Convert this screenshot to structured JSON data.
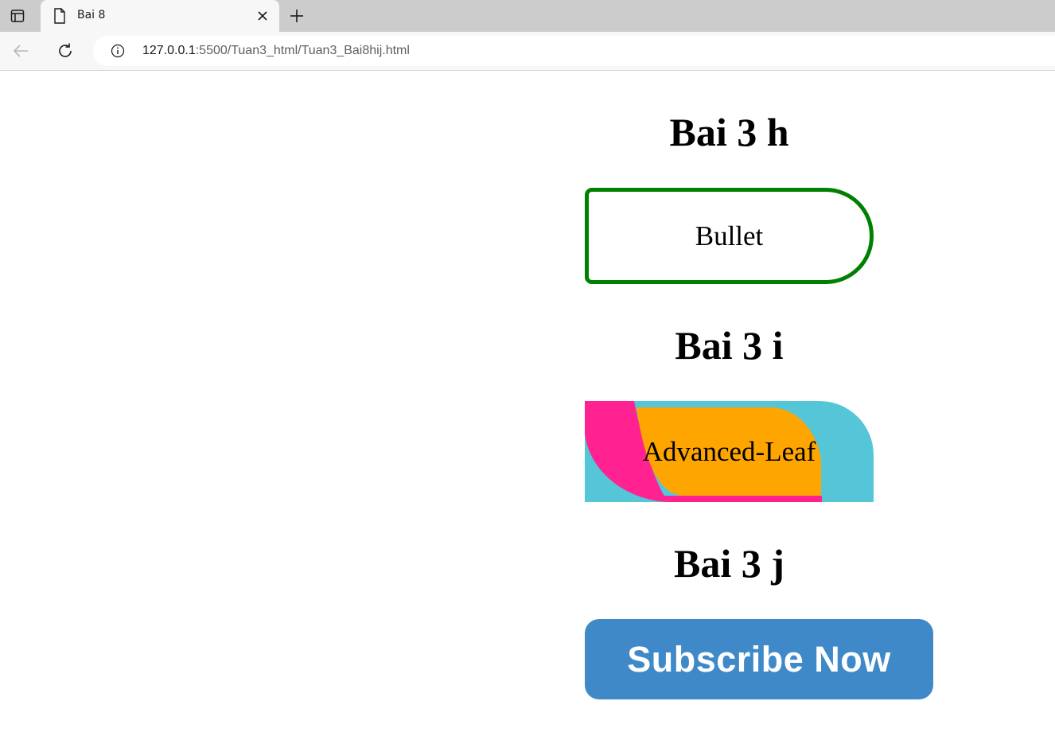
{
  "browser": {
    "tab_title": "Bai 8",
    "url_host": "127.0.0.1",
    "url_rest": ":5500/Tuan3_html/Tuan3_Bai8hij.html"
  },
  "page": {
    "section_h": {
      "title": "Bai 3 h",
      "button_label": "Bullet"
    },
    "section_i": {
      "title": "Bai 3 i",
      "button_label": "Advanced-Leaf"
    },
    "section_j": {
      "title": "Bai 3 j",
      "button_label": "Subscribe Now"
    }
  },
  "colors": {
    "bullet_border": "#008000",
    "leaf_pink": "#ff2290",
    "leaf_cyan": "#55c5d8",
    "leaf_orange": "#ffa500",
    "subscribe_bg": "#3f89c9"
  }
}
